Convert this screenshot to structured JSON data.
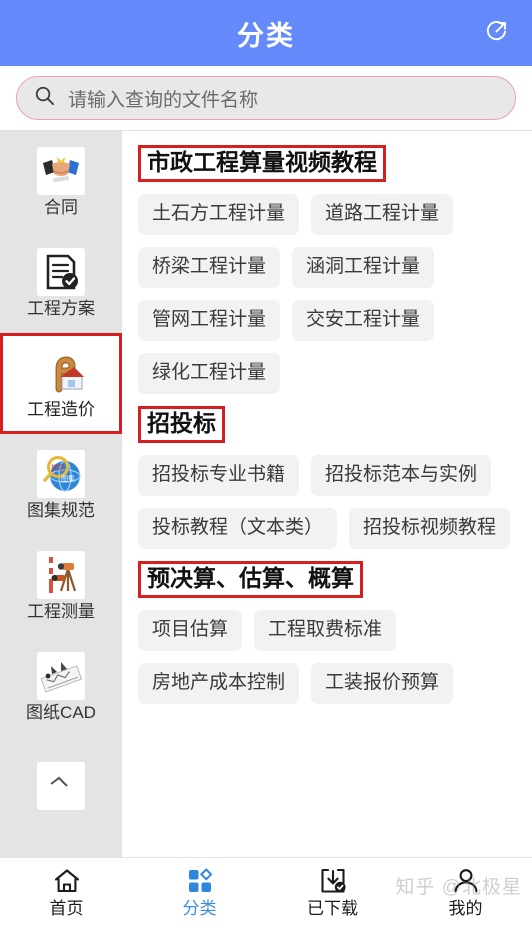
{
  "header": {
    "title": "分类",
    "share_icon": "share-circle-icon",
    "background": "#6389fb"
  },
  "search": {
    "icon": "search-icon",
    "placeholder": "请输入查询的文件名称",
    "value": "",
    "border_color": "#e8a0ab",
    "fill_color": "#e8e8e8"
  },
  "sidebar": {
    "active_index": 2,
    "active_border_color": "#d61f1f",
    "items": [
      {
        "label": "合同",
        "icon": "handshake-icon"
      },
      {
        "label": "工程方案",
        "icon": "document-check-icon"
      },
      {
        "label": "工程造价",
        "icon": "house-cost-icon"
      },
      {
        "label": "图集规范",
        "icon": "magnifier-globe-icon"
      },
      {
        "label": "工程测量",
        "icon": "survey-tripod-icon"
      },
      {
        "label": "图纸CAD",
        "icon": "blueprint-icon"
      },
      {
        "label": "",
        "icon": "partial-item-icon"
      }
    ]
  },
  "content": {
    "sections": [
      {
        "title": "市政工程算量视频教程",
        "chips": [
          "土石方工程计量",
          "道路工程计量",
          "桥梁工程计量",
          "涵洞工程计量",
          "管网工程计量",
          "交安工程计量",
          "绿化工程计量"
        ]
      },
      {
        "title": "招投标",
        "chips": [
          "招投标专业书籍",
          "招投标范本与实例",
          "投标教程（文本类）",
          "招投标视频教程"
        ]
      },
      {
        "title": "预决算、估算、概算",
        "chips": [
          "项目估算",
          "工程取费标准",
          "房地产成本控制",
          "工装报价预算"
        ]
      }
    ]
  },
  "tabbar": {
    "active_index": 1,
    "active_color": "#3c8ce0",
    "items": [
      {
        "label": "首页",
        "icon": "home-icon"
      },
      {
        "label": "分类",
        "icon": "grid-category-icon"
      },
      {
        "label": "已下载",
        "icon": "download-check-icon"
      },
      {
        "label": "我的",
        "icon": "user-profile-icon"
      }
    ]
  },
  "watermark": {
    "text": "知乎 @北极星"
  }
}
